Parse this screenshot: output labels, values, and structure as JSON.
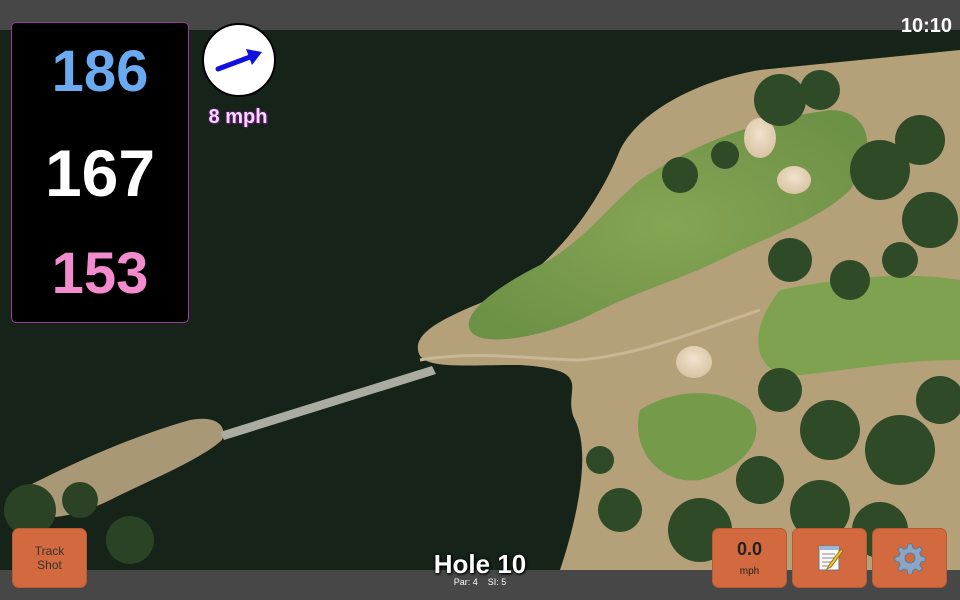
{
  "status_bar": {
    "time": "10:10"
  },
  "distances": {
    "back": "186",
    "middle": "167",
    "front": "153"
  },
  "wind": {
    "speed": "8 mph",
    "direction_icon": "arrow-icon"
  },
  "buttons": {
    "track_shot": "Track\nShot",
    "speed_value": "0.0",
    "speed_unit": "mph",
    "notes_icon": "notepad-icon",
    "settings_icon": "gear-icon"
  },
  "hole": {
    "title": "Hole 10",
    "par": "Par: 4",
    "si": "SI: 5"
  },
  "colors": {
    "back_distance": "#6aaaf0",
    "middle_distance": "#ffffff",
    "front_distance": "#f28ccf",
    "button": "#d2693f",
    "wind_arrow": "#1010e0",
    "water": "#162319"
  }
}
